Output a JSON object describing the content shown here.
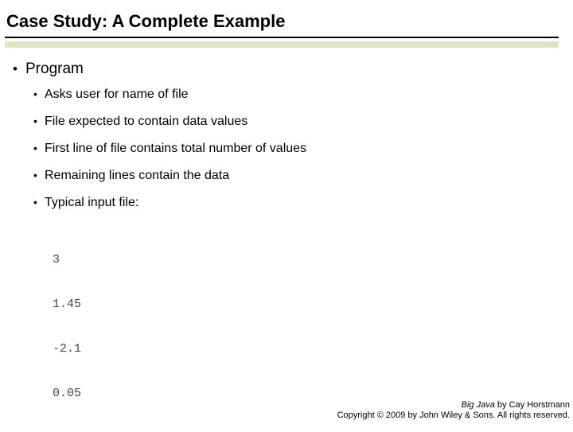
{
  "title": "Case Study: A Complete Example",
  "bullets": {
    "lvl1": "Program",
    "lvl2": [
      "Asks user for name of file",
      "File expected to contain data values",
      "First line of file contains total number of values",
      "Remaining lines contain the data",
      "Typical input file:"
    ]
  },
  "code_lines": [
    "3",
    "1.45",
    "-2.1",
    "0.05"
  ],
  "footer": {
    "book": "Big Java",
    "author_suffix": " by Cay Horstmann",
    "copyright": "Copyright © 2009 by John Wiley & Sons. All rights reserved."
  }
}
